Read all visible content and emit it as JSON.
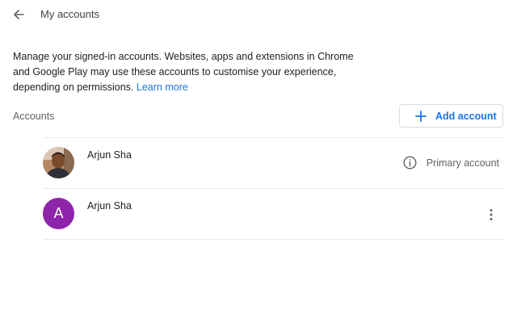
{
  "header": {
    "back_icon": "arrow-back-icon",
    "title": "My accounts"
  },
  "description": {
    "text": "Manage your signed-in accounts. Websites, apps and extensions in Chrome and Google Play may use these accounts to customise your experience, depending on permissions.",
    "learn_more": "Learn more"
  },
  "accounts": {
    "label": "Accounts",
    "add_button": {
      "icon": "plus-icon",
      "label": "Add account"
    },
    "items": [
      {
        "name": "Arjun Sha",
        "avatar_type": "photo",
        "status_icon": "info-icon",
        "status": "Primary account"
      },
      {
        "name": "Arjun Sha",
        "avatar_type": "letter",
        "avatar_letter": "A",
        "avatar_color": "#8e24aa",
        "menu_icon": "more-vert-icon"
      }
    ]
  },
  "colors": {
    "accent": "#1a73e8",
    "divider": "#e8eaed"
  }
}
